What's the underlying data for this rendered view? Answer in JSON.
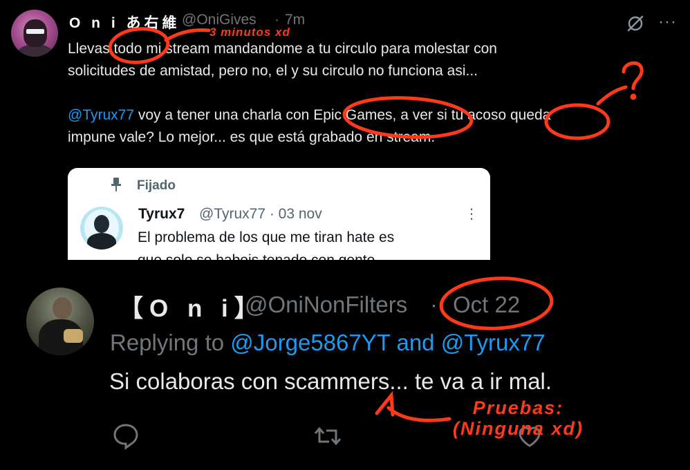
{
  "tweet1": {
    "display_name": "O n i あ右維",
    "handle": "@OniGives",
    "separator": "·",
    "time": "7m",
    "line1": "Llevas todo mi stream mandandome a tu circulo para molestar con",
    "line2": "solicitudes de amistad, pero no, el y su circulo no funciona asi...",
    "line3_mention": "@Tyrux77",
    "line3_rest": " voy a tener una charla con Epic Games, a ver si tu acoso queda",
    "line4": "impune vale? Lo mejor... es que está grabado en stream.",
    "icons": {
      "grok": "grok-icon",
      "more": "more-icon"
    }
  },
  "quote": {
    "pinned_label": "Fijado",
    "name": "Tyrux7",
    "handle": "@Tyrux77 · 03 nov",
    "text_line1": "El problema de los que me tiran hate es",
    "text_line2": "que solo se habeis tenado con gente",
    "icons": {
      "pin": "pin-icon",
      "more": "more-vertical-icon"
    }
  },
  "tweet2": {
    "display_name": "【O n i】",
    "handle": "@OniNonFilters",
    "separator": "·",
    "time": "Oct 22",
    "replying_prefix": "Replying to ",
    "replying_mentions": "@Jorge5867YT and @Tyrux77",
    "text": "Si colaboras con scammers... te va a ir mal.",
    "icons": [
      "reply-icon",
      "retweet-icon",
      "like-icon"
    ]
  },
  "annotations": {
    "note_top": "3 minutos xd",
    "note_bottom_line1": "Pruebas:",
    "note_bottom_line2": "(Ninguna xd)",
    "question_mark": "?",
    "color": "#ff3a1a"
  },
  "colors": {
    "background": "#000000",
    "text": "#e7e9ea",
    "muted": "#71767b",
    "link": "#1d9bf0",
    "annotation": "#ff3a1a"
  }
}
